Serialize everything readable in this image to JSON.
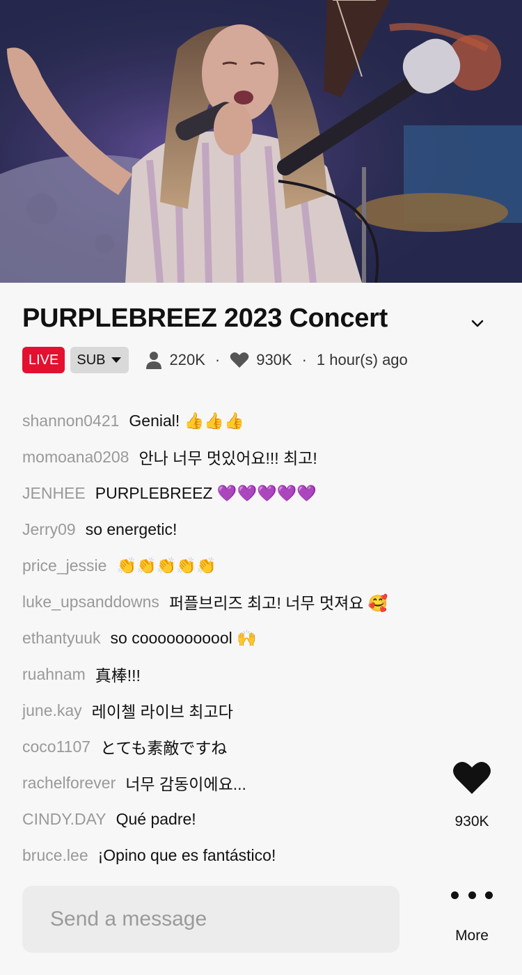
{
  "stream": {
    "title": "PURPLEBREEZ 2023 Concert",
    "live_label": "LIVE",
    "sub_label": "SUB",
    "viewers": "220K",
    "likes": "930K",
    "time_ago": "1 hour(s) ago"
  },
  "chat": [
    {
      "user": "shannon0421",
      "text": "Genial! 👍👍👍"
    },
    {
      "user": "momoana0208",
      "text": "안나 너무 멋있어요!!! 최고!"
    },
    {
      "user": "JENHEE",
      "text": "PURPLEBREEZ 💜💜💜💜💜"
    },
    {
      "user": "Jerry09",
      "text": "so energetic!"
    },
    {
      "user": "price_jessie",
      "text": "👏👏👏👏👏"
    },
    {
      "user": "luke_upsanddowns",
      "text": "퍼플브리즈 최고! 너무 멋져요 🥰"
    },
    {
      "user": "ethantyuuk",
      "text": "so cooooooooool 🙌"
    },
    {
      "user": "ruahnam",
      "text": "真棒!!!"
    },
    {
      "user": "june.kay",
      "text": "레이첼 라이브 최고다"
    },
    {
      "user": "coco1107",
      "text": "とても素敵ですね"
    },
    {
      "user": "rachelforever",
      "text": "너무 감동이에요..."
    },
    {
      "user": "CINDY.DAY",
      "text": "Qué padre!"
    },
    {
      "user": "bruce.lee",
      "text": "¡Opino que es fantástico!"
    }
  ],
  "actions": {
    "like_count": "930K",
    "more_label": "More",
    "like_icon": "heart-icon",
    "more_icon": "more-dots-icon"
  },
  "composer": {
    "placeholder": "Send a message",
    "value": ""
  },
  "colors": {
    "live_badge": "#e3102f",
    "sub_badge": "#d9d9d9",
    "username": "#999999",
    "background": "#f7f7f7"
  }
}
